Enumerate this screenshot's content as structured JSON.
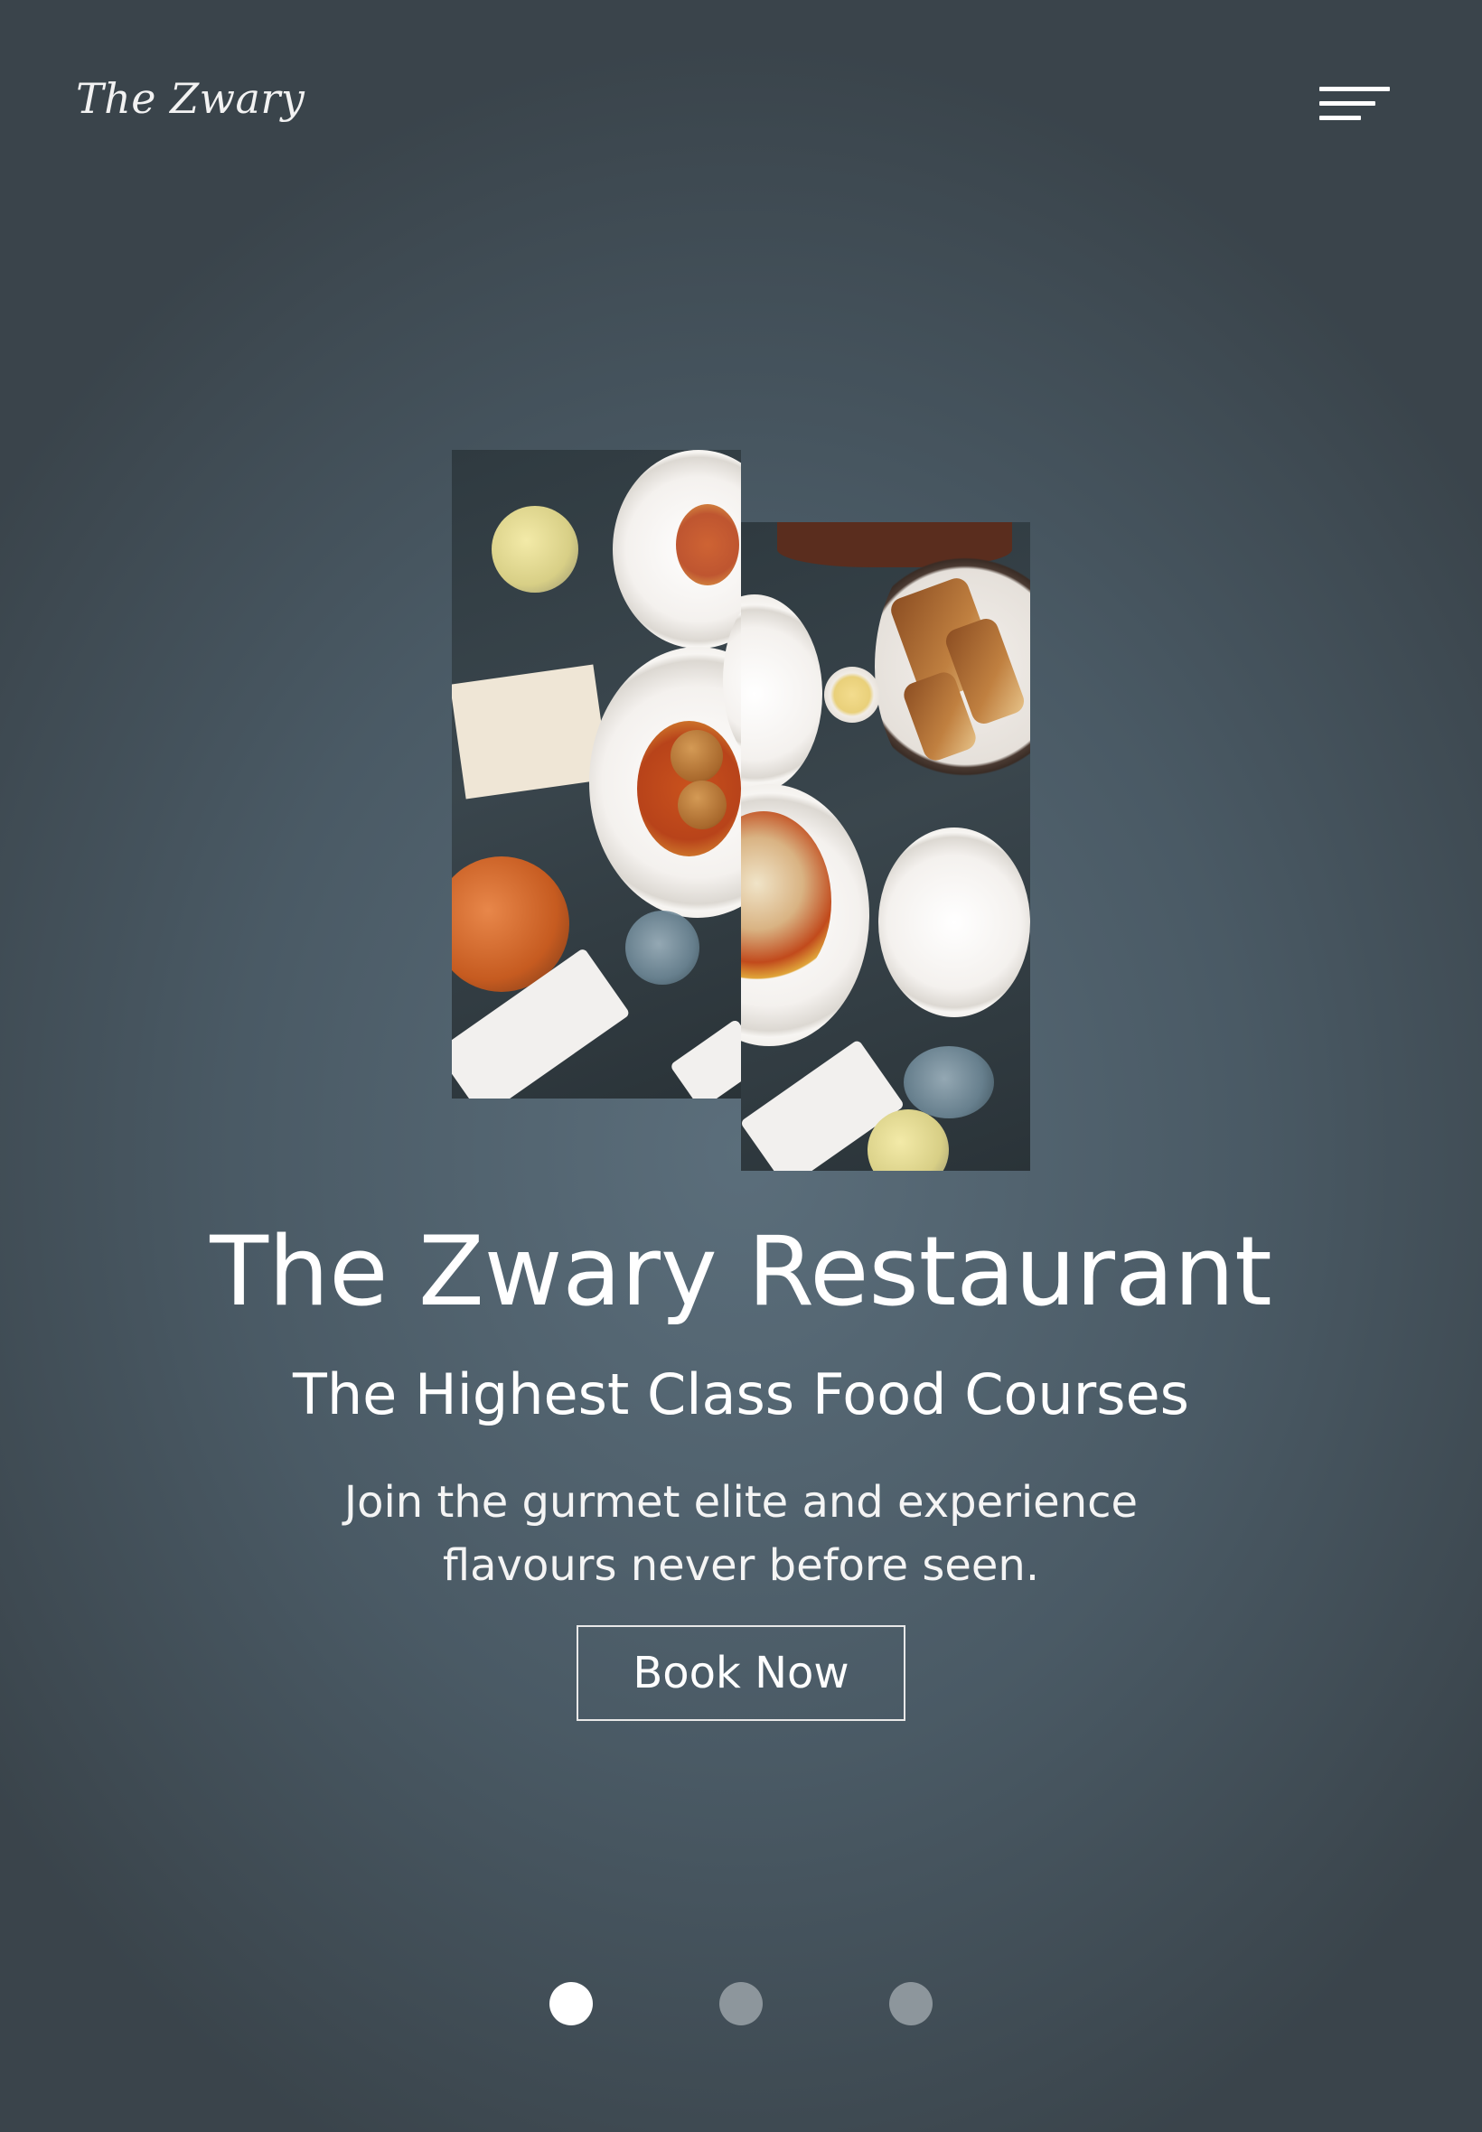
{
  "header": {
    "logo_text": "The Zwary",
    "menu_icon": "hamburger-menu-icon"
  },
  "hero": {
    "title": "The Zwary Restaurant",
    "subtitle": "The Highest Class Food Courses",
    "description_line1": "Join the gurmet elite and experience",
    "description_line2": "flavours never before seen.",
    "cta_label": "Book Now"
  },
  "carousel": {
    "slide_count": 3,
    "active_index": 0
  },
  "colors": {
    "background_center": "#5b6e7b",
    "background_edge": "#3a444b",
    "text": "#ffffff",
    "dot_inactive": "#8d969c"
  }
}
